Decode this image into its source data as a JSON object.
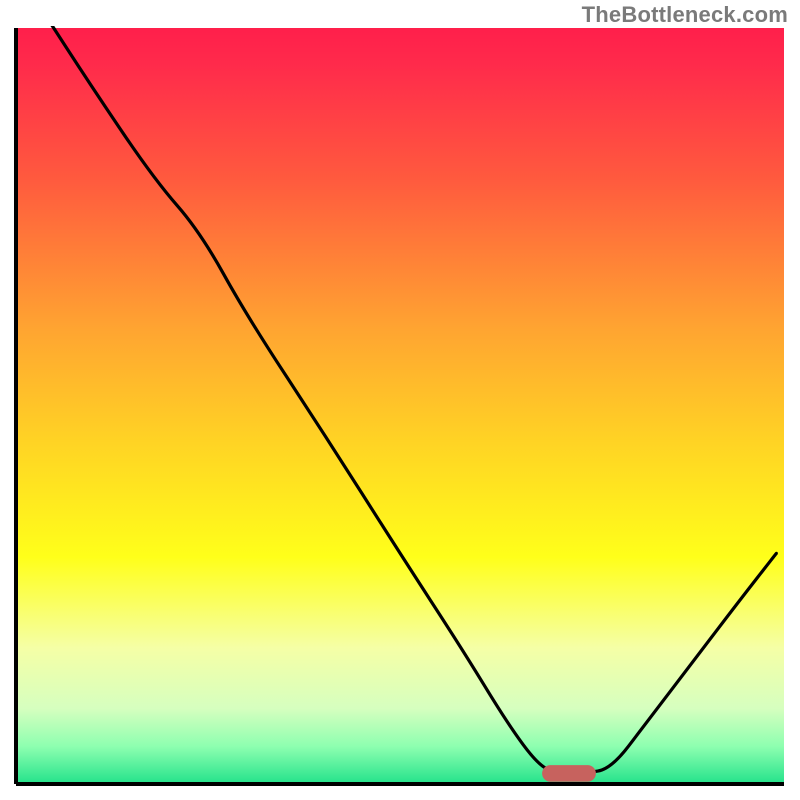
{
  "attribution": "TheBottleneck.com",
  "chart_data": {
    "type": "line",
    "title": "",
    "xlabel": "",
    "ylabel": "",
    "xlim": [
      0,
      100
    ],
    "ylim": [
      0,
      100
    ],
    "gradient_stops": [
      {
        "offset": 0.0,
        "color": "#ff1f4b"
      },
      {
        "offset": 0.05,
        "color": "#ff2b4b"
      },
      {
        "offset": 0.2,
        "color": "#ff5a3e"
      },
      {
        "offset": 0.4,
        "color": "#ffa531"
      },
      {
        "offset": 0.55,
        "color": "#ffd424"
      },
      {
        "offset": 0.7,
        "color": "#ffff1a"
      },
      {
        "offset": 0.82,
        "color": "#f5ffa6"
      },
      {
        "offset": 0.9,
        "color": "#d6ffbf"
      },
      {
        "offset": 0.95,
        "color": "#8effb0"
      },
      {
        "offset": 1.0,
        "color": "#23e28b"
      }
    ],
    "series": [
      {
        "name": "curve",
        "points": [
          {
            "x": 3.0,
            "y": 103.0
          },
          {
            "x": 10.0,
            "y": 92.0
          },
          {
            "x": 18.0,
            "y": 80.0
          },
          {
            "x": 24.0,
            "y": 73.0
          },
          {
            "x": 30.0,
            "y": 62.0
          },
          {
            "x": 40.0,
            "y": 46.5
          },
          {
            "x": 50.0,
            "y": 30.5
          },
          {
            "x": 58.0,
            "y": 18.0
          },
          {
            "x": 64.0,
            "y": 8.0
          },
          {
            "x": 68.0,
            "y": 2.5
          },
          {
            "x": 70.5,
            "y": 1.4
          },
          {
            "x": 74.0,
            "y": 1.4
          },
          {
            "x": 77.5,
            "y": 2.0
          },
          {
            "x": 82.0,
            "y": 8.0
          },
          {
            "x": 88.0,
            "y": 16.0
          },
          {
            "x": 94.0,
            "y": 24.0
          },
          {
            "x": 99.0,
            "y": 30.5
          }
        ]
      }
    ],
    "marker": {
      "x": 72.0,
      "y": 1.4,
      "width": 7.0,
      "height": 2.2,
      "color": "#c7625e"
    },
    "axes_color": "#000000",
    "curve_color": "#000000"
  }
}
